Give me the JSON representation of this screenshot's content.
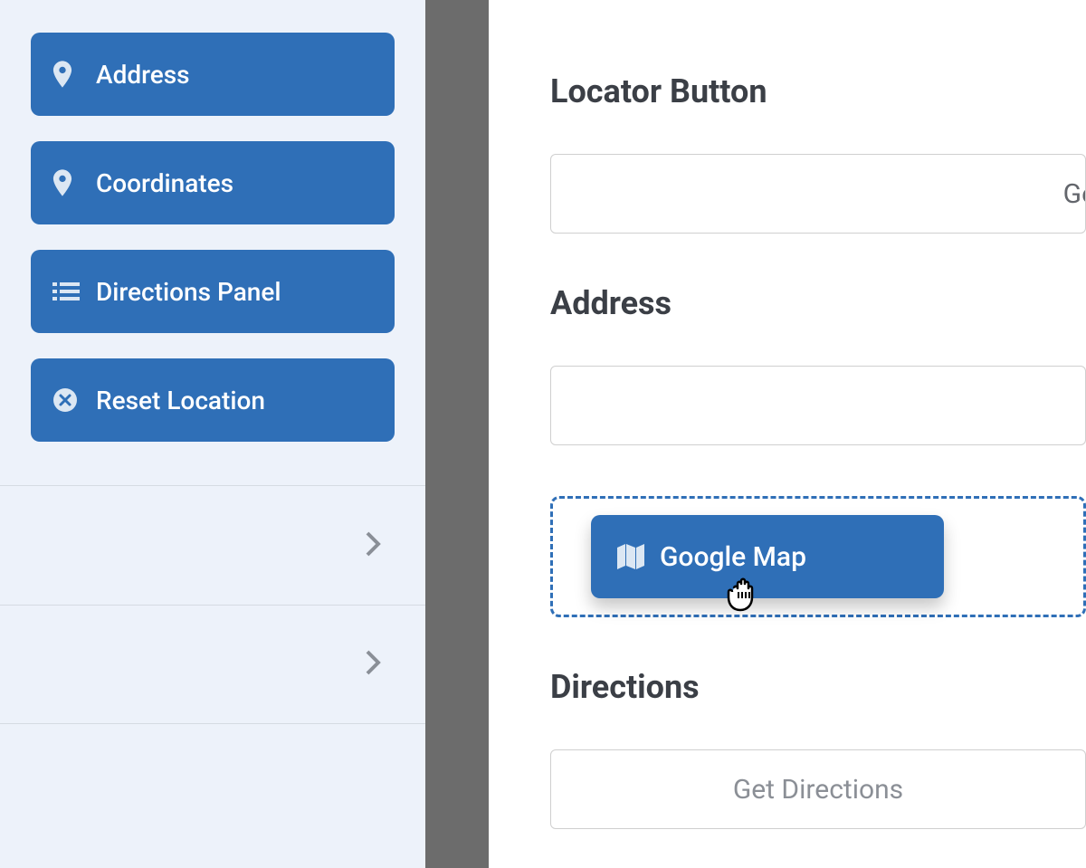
{
  "sidebar": {
    "buttons": [
      {
        "label": "Address"
      },
      {
        "label": "Coordinates"
      },
      {
        "label": "Directions Panel"
      },
      {
        "label": "Reset Location"
      }
    ]
  },
  "main": {
    "locator_title": "Locator Button",
    "locator_partial": "Ge",
    "address_title": "Address",
    "map_chip": "Google Map",
    "directions_title": "Directions",
    "directions_button": "Get Directions"
  }
}
